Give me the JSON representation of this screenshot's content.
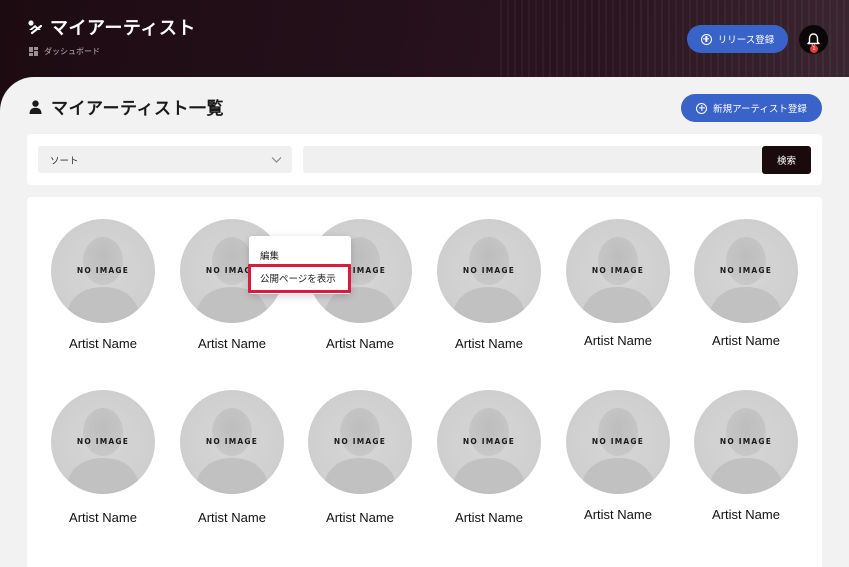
{
  "app": {
    "title": "マイアーティスト",
    "breadcrumb": "ダッシュボード"
  },
  "header": {
    "release_button": "リリース登録",
    "notification_count": "1"
  },
  "page": {
    "title": "マイアーティスト一覧",
    "new_artist_button": "新規アーティスト登録"
  },
  "filter": {
    "sort_value": "ソート",
    "search_placeholder": "",
    "search_button": "検索"
  },
  "artists": [
    {
      "name": "Artist Name",
      "placeholder": "NO IMAGE"
    },
    {
      "name": "Artist Name",
      "placeholder": "NO IMAGE"
    },
    {
      "name": "Artist Name",
      "placeholder": "NO IMAGE"
    },
    {
      "name": "Artist Name",
      "placeholder": "NO IMAGE"
    },
    {
      "name": "Artist Name",
      "placeholder": "NO IMAGE"
    },
    {
      "name": "Artist Name",
      "placeholder": "NO IMAGE"
    },
    {
      "name": "Artist Name",
      "placeholder": "NO IMAGE"
    },
    {
      "name": "Artist Name",
      "placeholder": "NO IMAGE"
    },
    {
      "name": "Artist Name",
      "placeholder": "NO IMAGE"
    },
    {
      "name": "Artist Name",
      "placeholder": "NO IMAGE"
    },
    {
      "name": "Artist Name",
      "placeholder": "NO IMAGE"
    },
    {
      "name": "Artist Name",
      "placeholder": "NO IMAGE"
    }
  ],
  "context_menu": {
    "items": [
      "編集",
      "公開ページを表示"
    ]
  },
  "colors": {
    "primary_button": "#3a63c9",
    "header_bg": "#1d0b12",
    "highlight": "#d81b3f",
    "search_button": "#1a0a0e"
  }
}
